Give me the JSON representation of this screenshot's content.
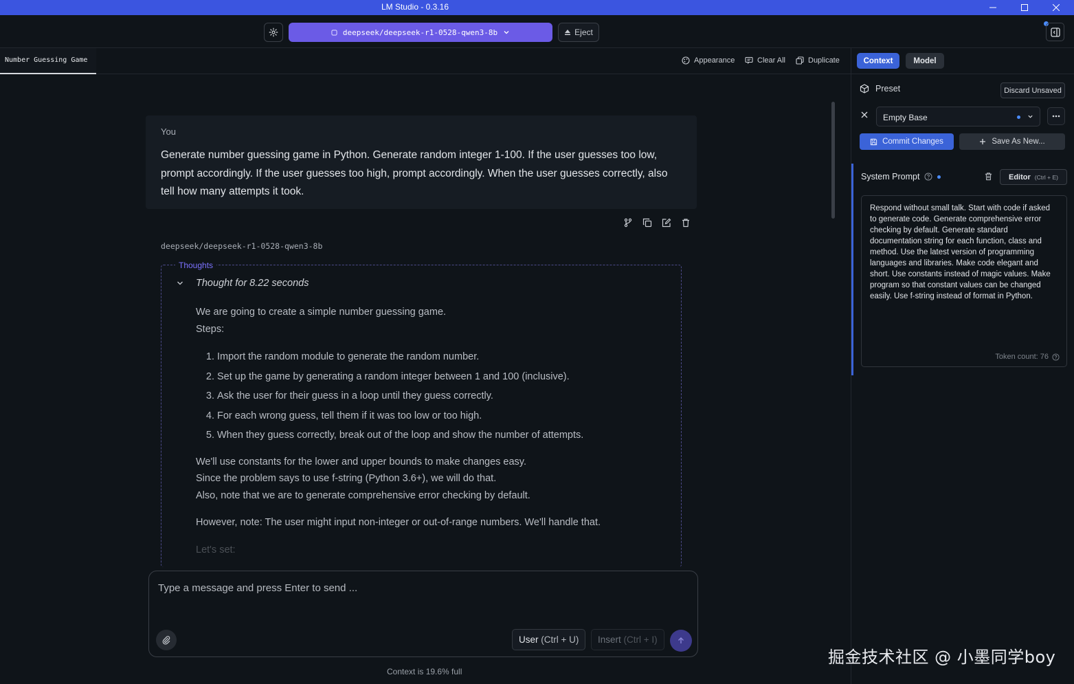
{
  "window": {
    "title": "LM Studio - 0.3.16"
  },
  "toolbar": {
    "model": "deepseek/deepseek-r1-0528-qwen3-8b",
    "eject_label": "Eject"
  },
  "chat_header": {
    "tab_title": "Number Guessing Game",
    "actions": {
      "appearance": "Appearance",
      "clear_all": "Clear All",
      "duplicate": "Duplicate"
    }
  },
  "conversation": {
    "user": {
      "role": "You",
      "text": "Generate number guessing game in Python. Generate random integer 1-100. If the user guesses too low, prompt accordingly. If the user guesses too high, prompt accordingly. When the user guesses correctly, also tell how many attempts it took."
    },
    "assistant": {
      "model": "deepseek/deepseek-r1-0528-qwen3-8b",
      "thoughts_label": "Thoughts",
      "thought_time": "Thought for 8.22 seconds",
      "intro": [
        "We are going to create a simple number guessing game.",
        "Steps:"
      ],
      "steps": [
        "Import the random module to generate the random number.",
        "Set up the game by generating a random integer between 1 and 100 (inclusive).",
        "Ask the user for their guess in a loop until they guess correctly.",
        "For each wrong guess, tell them if it was too low or too high.",
        "When they guess correctly, break out of the loop and show the number of attempts."
      ],
      "notes": [
        "We'll use constants for the lower and upper bounds to make changes easy.",
        "Since the problem says to use f-string (Python 3.6+), we will do that.",
        "Also, note that we are to generate comprehensive error checking by default."
      ],
      "note2": "However, note: The user might input non-integer or out-of-range numbers. We'll handle that.",
      "fade": "Let's set:"
    }
  },
  "input": {
    "placeholder": "Type a message and press Enter to send ...",
    "user_btn": "User",
    "user_shortcut": "(Ctrl + U)",
    "insert_btn": "Insert",
    "insert_shortcut": "(Ctrl + I)"
  },
  "context_status": "Context is 19.6% full",
  "watermark": "掘金技术社区 @ 小墨同学boy",
  "panel": {
    "tabs": [
      "Context",
      "Model"
    ],
    "preset_label": "Preset",
    "discard": "Discard Unsaved",
    "preset_value": "Empty Base",
    "commit": "Commit Changes",
    "save_as": "Save As New...",
    "system_prompt_label": "System Prompt",
    "editor_btn": "Editor",
    "editor_shortcut": "(Ctrl + E)",
    "system_prompt": "Respond without small talk. Start with code if asked to generate code. Generate comprehensive error checking by default. Generate standard documentation string for each function, class and method. Use the latest version of programming languages and libraries. Make code elegant and short. Use constants instead of magic values. Make program so that constant values can be changed easily. Use f-string instead of format in Python.",
    "token_count": "Token count: 76"
  },
  "colors": {
    "titlebar": "#3b55e0",
    "model_select": "#6b5be6",
    "accent": "#3b63d8",
    "thoughts_border": "#4c4a8a"
  }
}
